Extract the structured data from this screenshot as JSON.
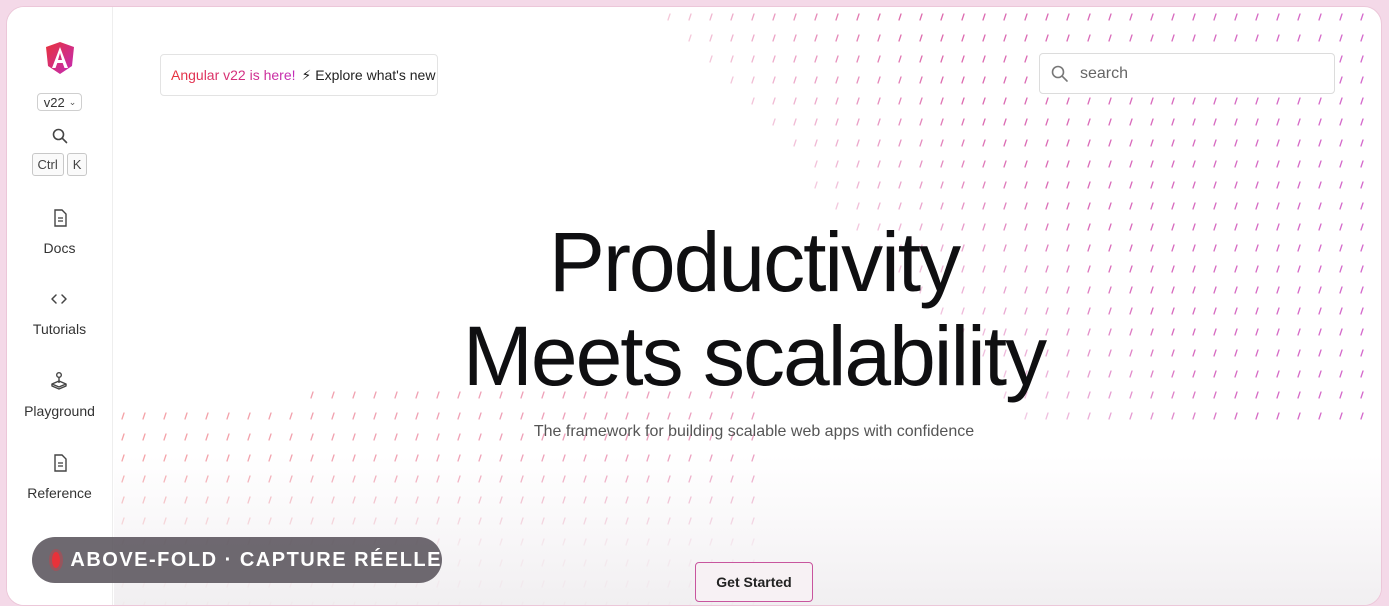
{
  "sidebar": {
    "logo_icon": "angular-logo-icon",
    "version": "v22",
    "search_icon": "search-icon",
    "shortcut_keys": [
      "Ctrl",
      "K"
    ],
    "items": [
      {
        "label": "Docs",
        "icon": "document-icon"
      },
      {
        "label": "Tutorials",
        "icon": "code-icon"
      },
      {
        "label": "Playground",
        "icon": "joystick-icon"
      },
      {
        "label": "Reference",
        "icon": "document-icon"
      }
    ]
  },
  "announcement": {
    "highlight": "Angular v22 is here!",
    "text": "⚡ Explore what's new"
  },
  "search": {
    "placeholder": "search"
  },
  "hero": {
    "title_line1": "Productivity",
    "title_line2": "Meets scalability",
    "subtitle": "The framework for building scalable web apps with confidence",
    "cta_label": "Get Started"
  },
  "overlay_badge": {
    "label": "ABOVE-FOLD · CAPTURE RÉELLE"
  },
  "colors": {
    "brand_red": "#e8323a",
    "brand_magenta": "#c22bb9",
    "badge_bg": "#5a545c"
  }
}
